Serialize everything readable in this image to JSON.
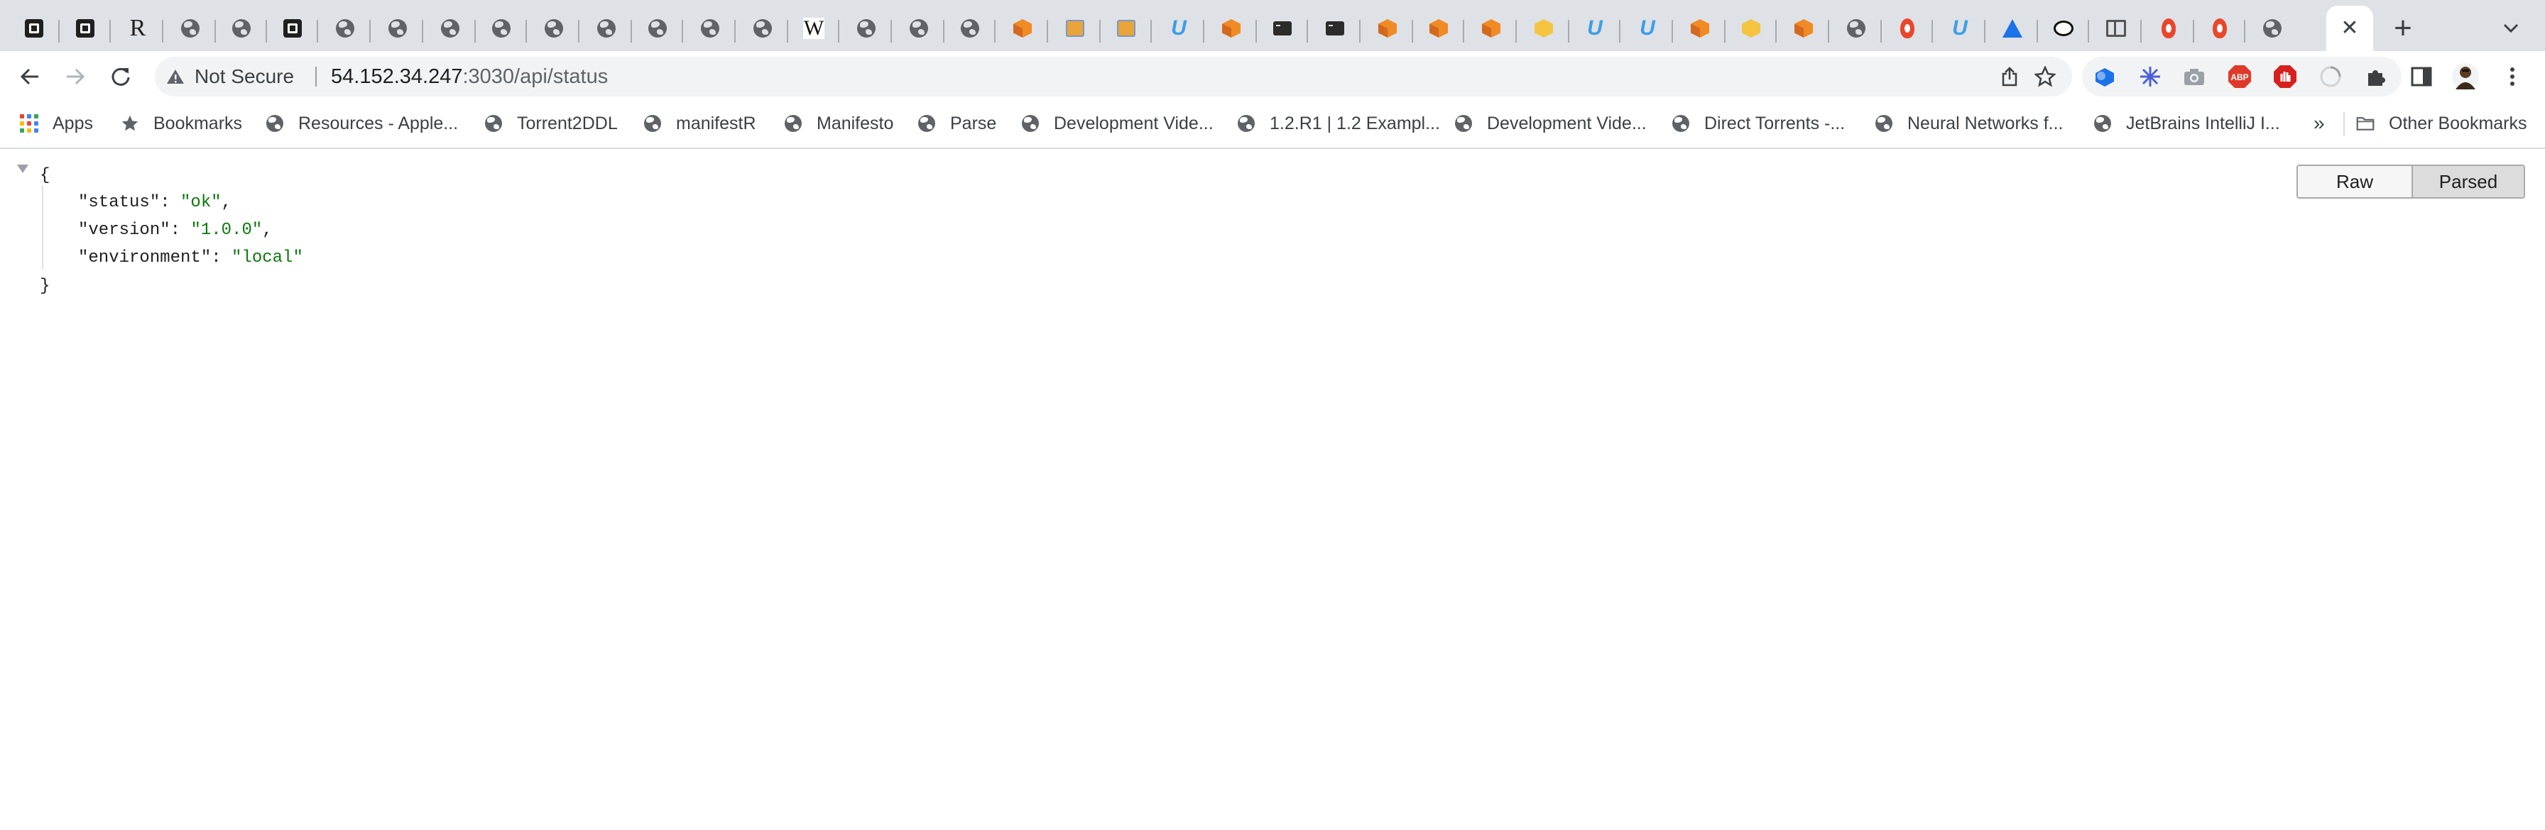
{
  "tabs": {
    "favicons": [
      "square-logo",
      "square-logo",
      "r-logo",
      "globe",
      "globe",
      "square-logo",
      "globe",
      "globe",
      "globe",
      "globe",
      "globe",
      "globe",
      "globe",
      "globe",
      "globe",
      "wikipedia-w",
      "globe",
      "globe",
      "globe",
      "orange-cube",
      "book",
      "book",
      "udemy-u",
      "orange-cube",
      "terminal",
      "terminal",
      "orange-cube",
      "orange-cube",
      "orange-cube",
      "yellow-cube",
      "udemy-u",
      "udemy-u",
      "orange-cube",
      "yellow-cube",
      "orange-cube",
      "globe",
      "flame",
      "udemy-u",
      "atlassian-a",
      "swan",
      "columns",
      "flame",
      "flame",
      "globe"
    ],
    "active_close": "✕",
    "new_tab": "+"
  },
  "toolbar": {
    "security_label": "Not Secure",
    "url_host": "54.152.34.247",
    "url_path": ":3030/api/status"
  },
  "bookmarks": {
    "items": [
      {
        "label": "Apps",
        "icon": "apps-grid-icon"
      },
      {
        "label": "Bookmarks",
        "icon": "star-icon"
      },
      {
        "label": "Resources - Apple...",
        "icon": "globe-icon"
      },
      {
        "label": "Torrent2DDL",
        "icon": "globe-icon"
      },
      {
        "label": "manifestR",
        "icon": "globe-icon"
      },
      {
        "label": "Manifesto",
        "icon": "globe-icon"
      },
      {
        "label": "Parse",
        "icon": "globe-icon"
      },
      {
        "label": "Development Vide...",
        "icon": "globe-icon"
      },
      {
        "label": "1.2.R1 | 1.2 Exampl...",
        "icon": "globe-icon"
      },
      {
        "label": "Development Vide...",
        "icon": "globe-icon"
      },
      {
        "label": "Direct Torrents -...",
        "icon": "globe-icon"
      },
      {
        "label": "Neural Networks f...",
        "icon": "globe-icon"
      },
      {
        "label": "JetBrains IntelliJ I...",
        "icon": "globe-icon"
      }
    ],
    "more": "»",
    "other": "Other Bookmarks"
  },
  "json": {
    "open_brace": "{",
    "close_brace": "}",
    "rows": [
      {
        "key": "\"status\"",
        "value": "\"ok\"",
        "trail": ","
      },
      {
        "key": "\"version\"",
        "value": "\"1.0.0\"",
        "trail": ","
      },
      {
        "key": "\"environment\"",
        "value": "\"local\"",
        "trail": ""
      }
    ]
  },
  "view_toggle": {
    "raw": "Raw",
    "parsed": "Parsed",
    "selected": "Parsed"
  },
  "colors": {
    "tabstrip": "#dee1e6",
    "json_string": "#0b7a0b",
    "omnibox": "#f1f3f4"
  }
}
